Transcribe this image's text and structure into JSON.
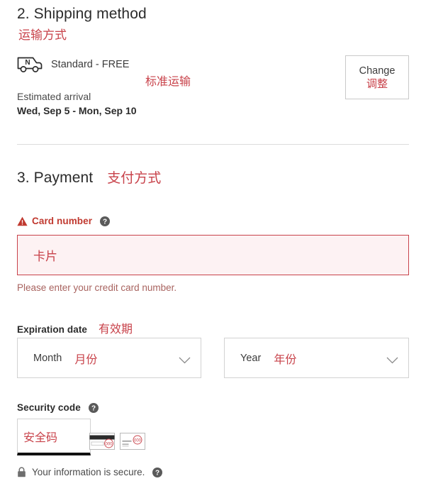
{
  "shipping": {
    "heading": "2. Shipping method",
    "heading_zh": "运输方式",
    "option_label": "Standard - FREE",
    "option_zh": "标准运输",
    "eta_label": "Estimated arrival",
    "eta_value": "Wed, Sep 5 - Mon, Sep 10",
    "change_label": "Change",
    "change_zh": "调整",
    "truck_icon_letter": "N"
  },
  "payment": {
    "heading": "3. Payment",
    "heading_zh": "支付方式",
    "card_number": {
      "label": "Card number",
      "value": "卡片",
      "placeholder": "",
      "error": "Please enter your credit card number."
    },
    "expiration": {
      "label": "Expiration date",
      "label_zh": "有效期",
      "month": {
        "label": "Month",
        "label_zh": "月份"
      },
      "year": {
        "label": "Year",
        "label_zh": "年份"
      }
    },
    "security_code": {
      "label": "Security code",
      "value": "安全码",
      "placeholder": ""
    },
    "secure_note": "Your information is secure."
  },
  "colors": {
    "accent_red": "#c8424a",
    "error_red": "#c0392f",
    "error_bg": "#fdf2f3",
    "text_dark": "#2b2b2b",
    "border_gray": "#d2d2d2"
  }
}
